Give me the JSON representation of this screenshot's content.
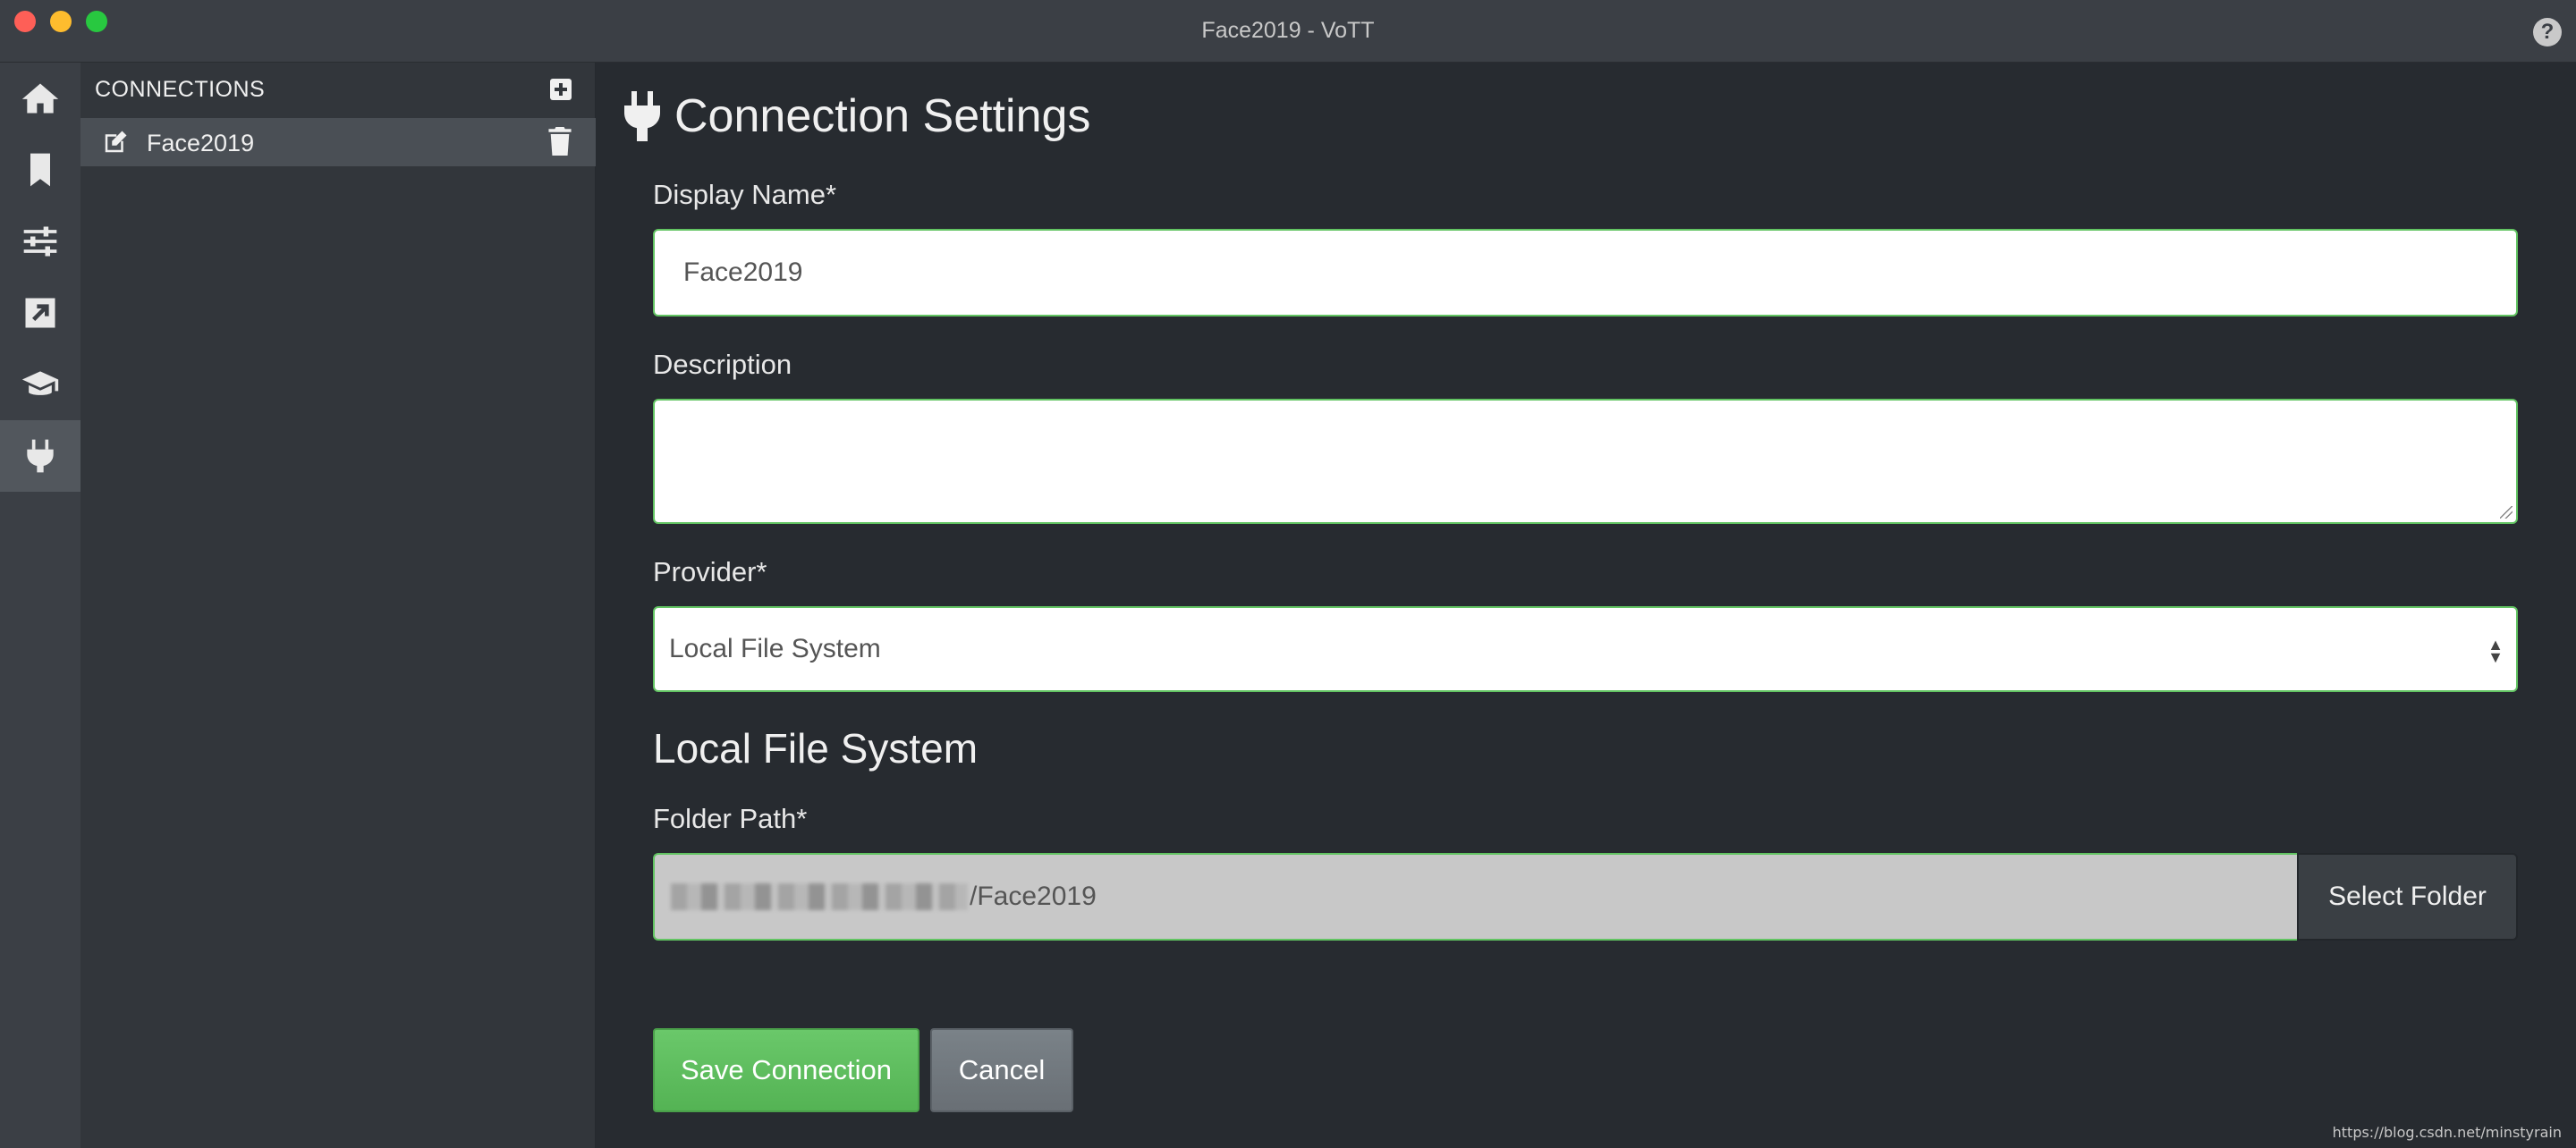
{
  "window": {
    "title": "Face2019 - VoTT",
    "help_glyph": "?"
  },
  "rail": {
    "items": [
      {
        "icon": "home-icon",
        "active": false
      },
      {
        "icon": "bookmark-icon",
        "active": false
      },
      {
        "icon": "sliders-icon",
        "active": false
      },
      {
        "icon": "export-icon",
        "active": false
      },
      {
        "icon": "graduation-cap-icon",
        "active": false
      },
      {
        "icon": "plug-icon",
        "active": true
      }
    ]
  },
  "connections": {
    "header": "CONNECTIONS",
    "items": [
      {
        "name": "Face2019"
      }
    ]
  },
  "form": {
    "title": "Connection Settings",
    "display_name_label": "Display Name*",
    "display_name_value": "Face2019",
    "description_label": "Description",
    "description_value": "",
    "provider_label": "Provider*",
    "provider_value": "Local File System",
    "section_title": "Local File System",
    "folder_path_label": "Folder Path*",
    "folder_path_visible": "/Face2019",
    "select_folder_label": "Select Folder",
    "save_label": "Save Connection",
    "cancel_label": "Cancel"
  },
  "watermark": "https://blog.csdn.net/minstyrain",
  "colors": {
    "accent_green": "#62c462",
    "background": "#272b30"
  }
}
